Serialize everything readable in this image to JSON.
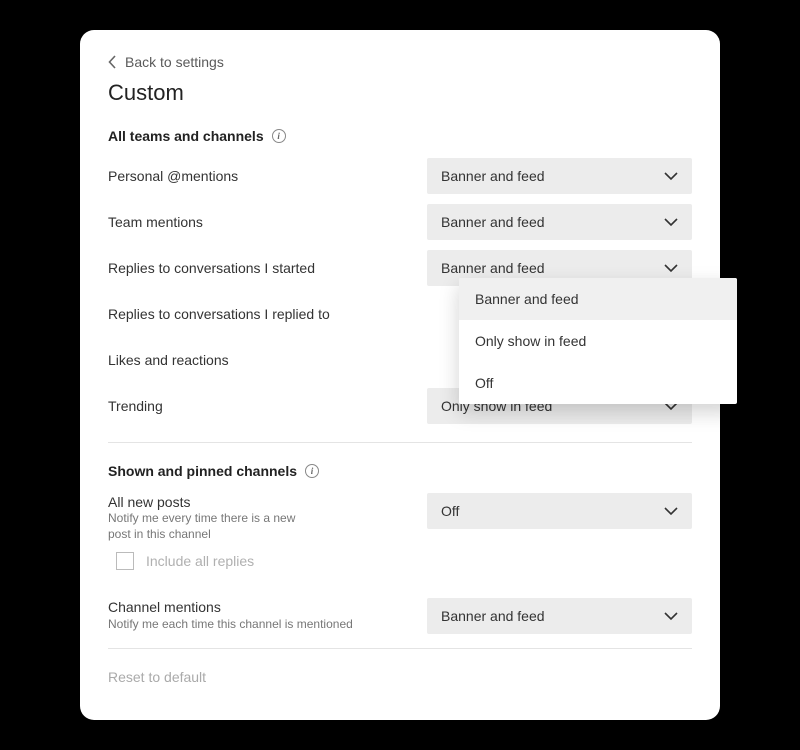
{
  "header": {
    "back_label": "Back to settings",
    "title": "Custom"
  },
  "section1": {
    "header": "All teams and channels",
    "rows": [
      {
        "label": "Personal @mentions",
        "value": "Banner and feed"
      },
      {
        "label": "Team mentions",
        "value": "Banner and feed"
      },
      {
        "label": "Replies to conversations I started",
        "value": "Banner and feed"
      },
      {
        "label": "Replies to conversations I replied to",
        "value": ""
      },
      {
        "label": "Likes and reactions",
        "value": ""
      },
      {
        "label": "Trending",
        "value": "Only show in feed"
      }
    ]
  },
  "dropdown": {
    "options": [
      "Banner and feed",
      "Only show in feed",
      "Off"
    ],
    "selected_index": 0
  },
  "section2": {
    "header": "Shown and pinned channels",
    "row1": {
      "label": "All new posts",
      "sublabel": "Notify me every time there is a new post in this channel",
      "value": "Off"
    },
    "checkbox": {
      "label": "Include all replies",
      "checked": false
    },
    "row2": {
      "label": "Channel mentions",
      "sublabel": "Notify me each time this channel is mentioned",
      "value": "Banner and feed"
    }
  },
  "footer": {
    "reset_label": "Reset to default"
  }
}
